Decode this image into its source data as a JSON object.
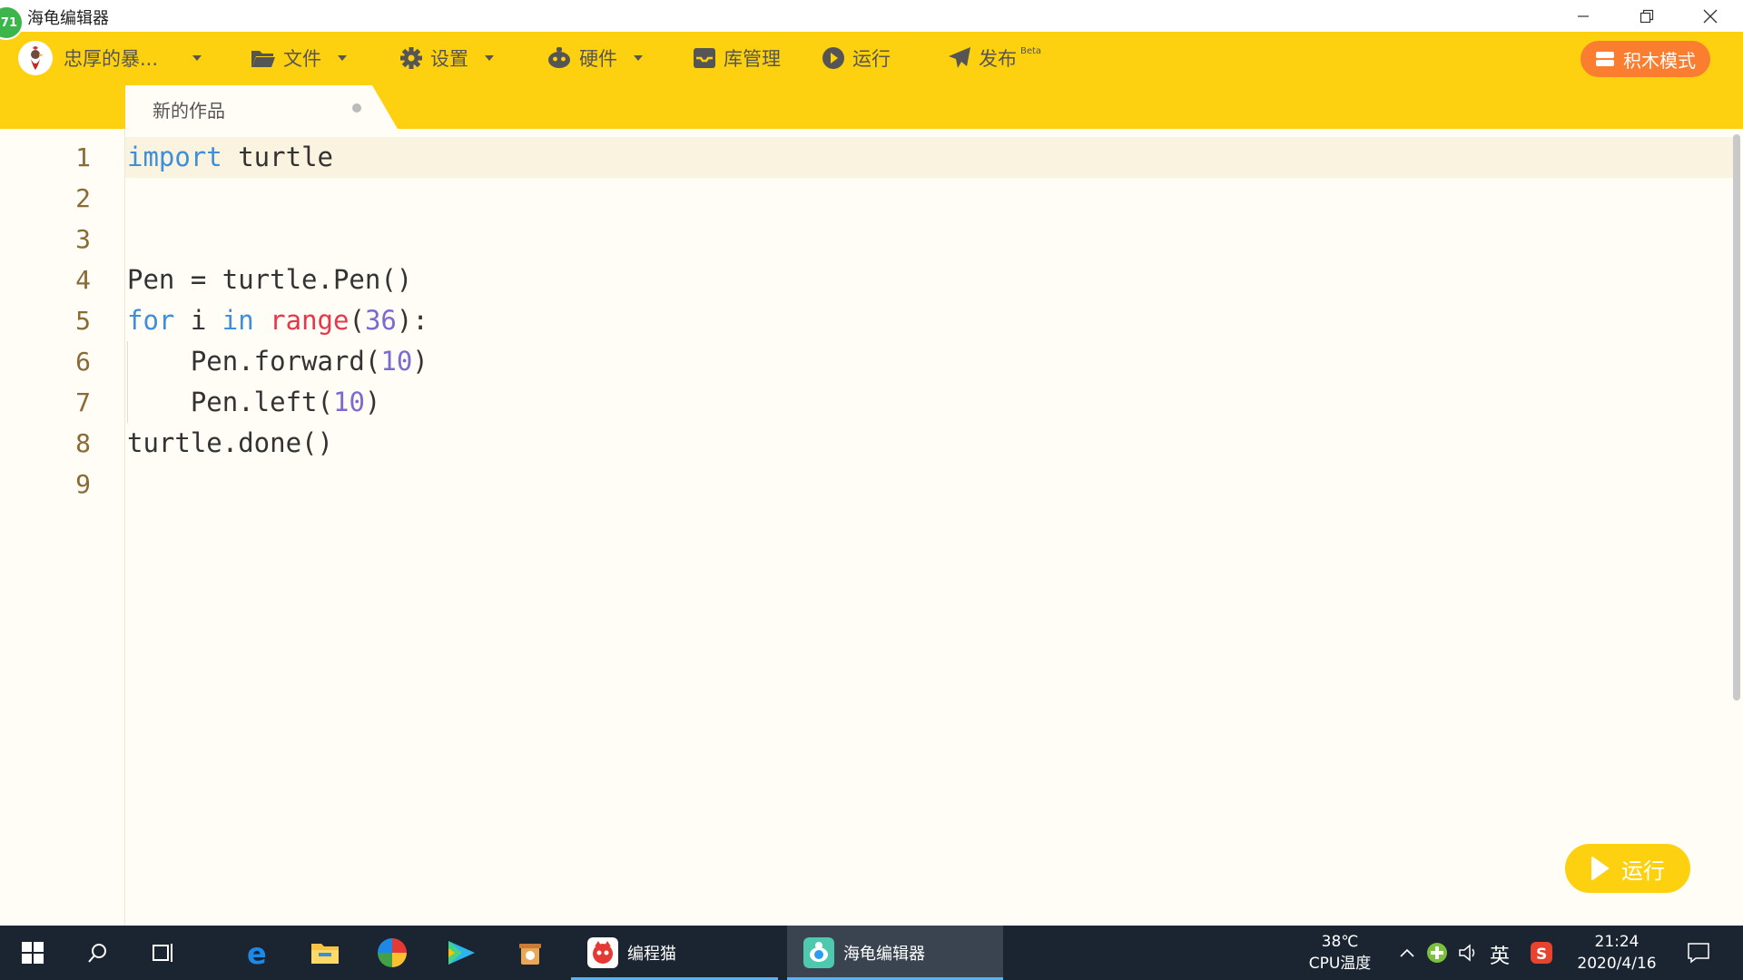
{
  "window": {
    "title": "海龟编辑器",
    "badge": "71"
  },
  "toolbar": {
    "user_name": "忠厚的暴...",
    "file_label": "文件",
    "settings_label": "设置",
    "hardware_label": "硬件",
    "library_label": "库管理",
    "run_label": "运行",
    "publish_label": "发布",
    "publish_tag": "Beta",
    "mode_button": "积木模式",
    "accent_color": "#fdd10f",
    "mode_color": "#fb7d2f"
  },
  "tab": {
    "label": "新的作品",
    "unsaved_indicator": "dot"
  },
  "editor": {
    "line_numbers": [
      "1",
      "2",
      "3",
      "4",
      "5",
      "6",
      "7",
      "8",
      "9"
    ],
    "lines": [
      [
        {
          "t": "import",
          "c": "kw"
        },
        {
          "t": " turtle",
          "c": ""
        }
      ],
      [],
      [],
      [
        {
          "t": "Pen = turtle.Pen()",
          "c": ""
        }
      ],
      [
        {
          "t": "for",
          "c": "kw"
        },
        {
          "t": " i ",
          "c": ""
        },
        {
          "t": "in",
          "c": "kw"
        },
        {
          "t": " ",
          "c": ""
        },
        {
          "t": "range",
          "c": "fn"
        },
        {
          "t": "(",
          "c": ""
        },
        {
          "t": "36",
          "c": "num"
        },
        {
          "t": "):",
          "c": ""
        }
      ],
      [
        {
          "t": "    Pen.forward(",
          "c": ""
        },
        {
          "t": "10",
          "c": "num"
        },
        {
          "t": ")",
          "c": ""
        }
      ],
      [
        {
          "t": "    Pen.left(",
          "c": ""
        },
        {
          "t": "10",
          "c": "num"
        },
        {
          "t": ")",
          "c": ""
        }
      ],
      [
        {
          "t": "turtle.done()",
          "c": ""
        }
      ],
      []
    ],
    "active_line": 1,
    "run_button": "运行"
  },
  "taskbar": {
    "apps": [
      {
        "label": "编程猫",
        "icon": "codemao-icon"
      },
      {
        "label": "海龟编辑器",
        "icon": "turtle-editor-icon",
        "active": true
      }
    ],
    "cpu_temp": "38℃",
    "cpu_label": "CPU温度",
    "ime": "英",
    "time": "21:24",
    "date": "2020/4/16"
  }
}
